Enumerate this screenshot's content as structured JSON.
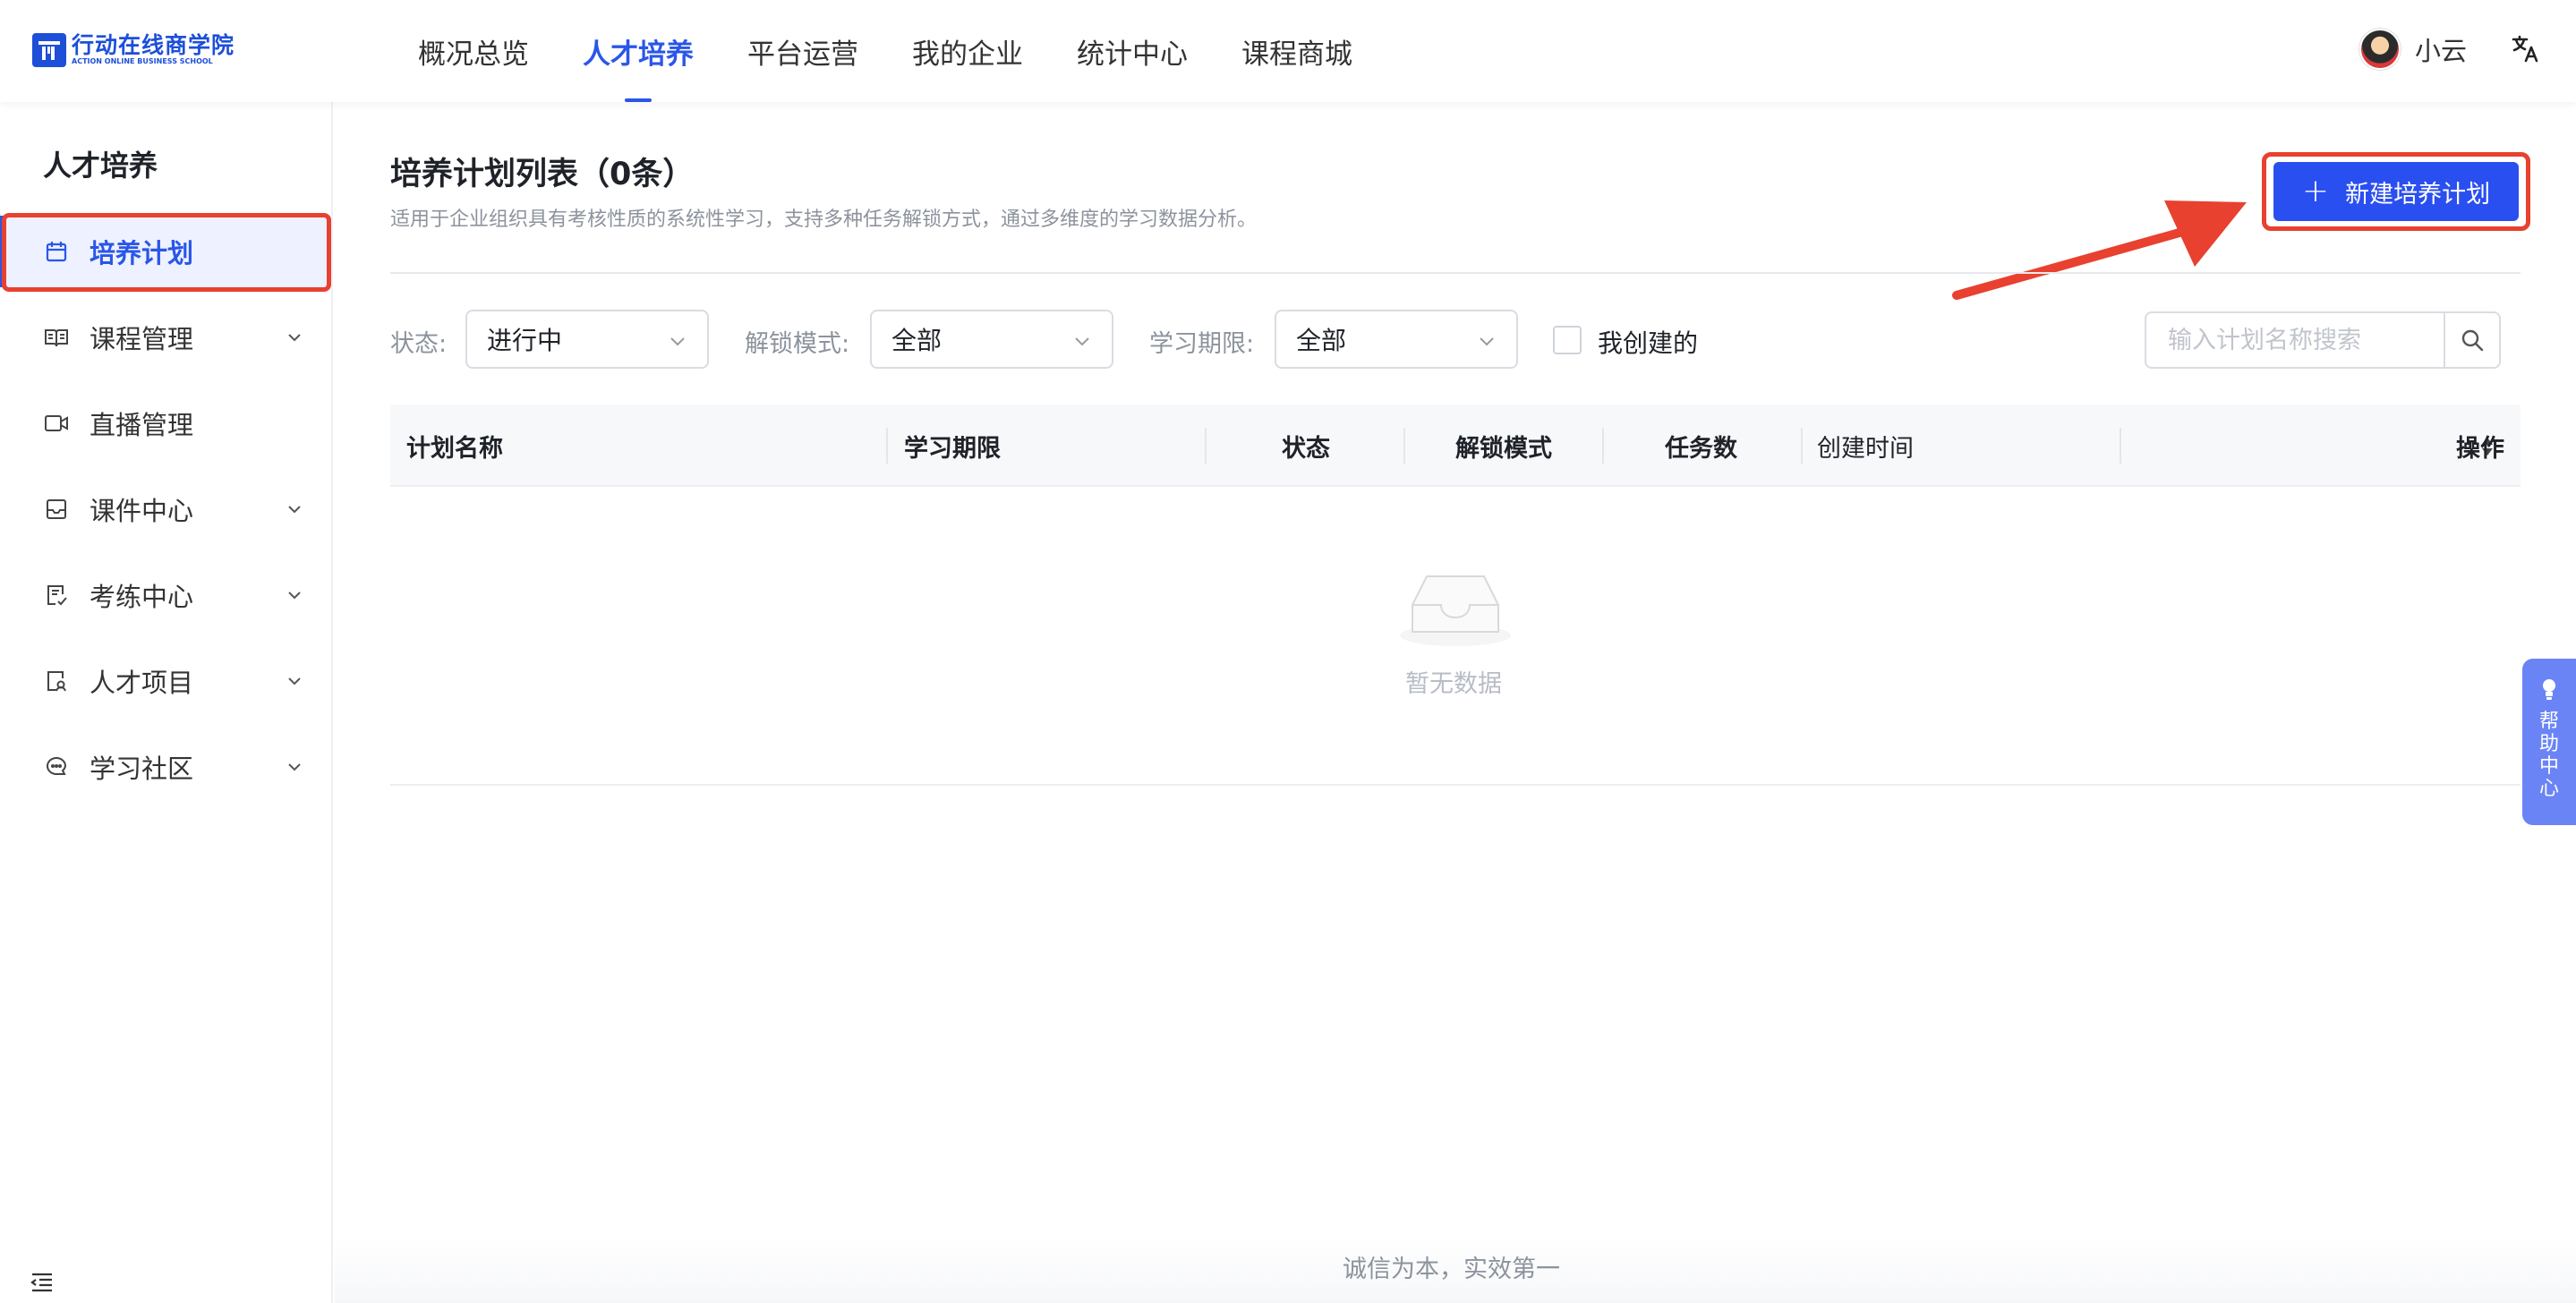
{
  "header": {
    "logo_cn": "行动在线商学院",
    "logo_en": "ACTION ONLINE BUSINESS SCHOOL",
    "nav": [
      {
        "label": "概况总览",
        "active": false
      },
      {
        "label": "人才培养",
        "active": true
      },
      {
        "label": "平台运营",
        "active": false
      },
      {
        "label": "我的企业",
        "active": false
      },
      {
        "label": "统计中心",
        "active": false
      },
      {
        "label": "课程商城",
        "active": false
      }
    ],
    "user_name": "小云",
    "translate_icon": "translate-icon"
  },
  "sidebar": {
    "title": "人才培养",
    "items": [
      {
        "label": "培养计划",
        "icon": "calendar-icon",
        "active": true,
        "expandable": false
      },
      {
        "label": "课程管理",
        "icon": "book-icon",
        "active": false,
        "expandable": true
      },
      {
        "label": "直播管理",
        "icon": "video-icon",
        "active": false,
        "expandable": false
      },
      {
        "label": "课件中心",
        "icon": "inbox-icon",
        "active": false,
        "expandable": true
      },
      {
        "label": "考练中心",
        "icon": "exam-icon",
        "active": false,
        "expandable": true
      },
      {
        "label": "人才项目",
        "icon": "project-icon",
        "active": false,
        "expandable": true
      },
      {
        "label": "学习社区",
        "icon": "chat-icon",
        "active": false,
        "expandable": true
      }
    ]
  },
  "main": {
    "title": "培养计划列表（0条）",
    "description": "适用于企业组织具有考核性质的系统性学习，支持多种任务解锁方式，通过多维度的学习数据分析。",
    "new_button": "新建培养计划",
    "filters": {
      "status_label": "状态:",
      "status_value": "进行中",
      "unlock_label": "解锁模式:",
      "unlock_value": "全部",
      "period_label": "学习期限:",
      "period_value": "全部",
      "created_by_me": "我创建的",
      "search_placeholder": "输入计划名称搜索"
    },
    "table": {
      "columns": [
        "计划名称",
        "学习期限",
        "状态",
        "解锁模式",
        "任务数",
        "创建时间",
        "操作"
      ],
      "rows": [],
      "empty_text": "暂无数据"
    }
  },
  "footer": {
    "slogan": "诚信为本，实效第一"
  },
  "help": {
    "label": "帮助中心"
  },
  "colors": {
    "accent": "#2a56e8",
    "button": "#2a4ff0",
    "highlight": "#e8412f",
    "help_tab": "#6b84f5"
  }
}
